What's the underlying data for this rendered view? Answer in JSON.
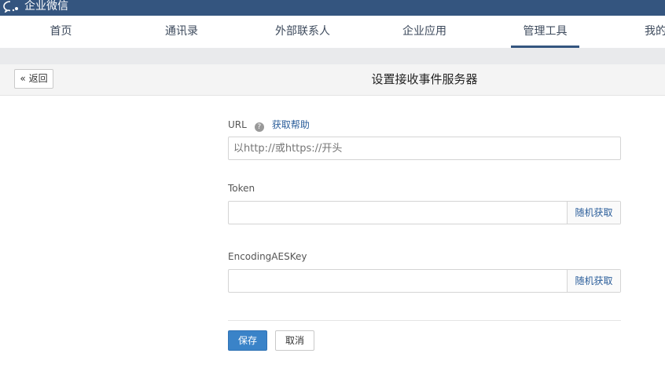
{
  "app": {
    "title": "企业微信"
  },
  "nav": {
    "items": [
      {
        "label": "首页"
      },
      {
        "label": "通讯录"
      },
      {
        "label": "外部联系人"
      },
      {
        "label": "企业应用"
      },
      {
        "label": "管理工具"
      },
      {
        "label": "我的企业"
      }
    ],
    "active": "管理工具"
  },
  "page": {
    "back_label": "返回",
    "title": "设置接收事件服务器"
  },
  "form": {
    "url": {
      "label": "URL",
      "help_link": "获取帮助",
      "placeholder": "以http://或https://开头",
      "value": ""
    },
    "token": {
      "label": "Token",
      "value": "",
      "button": "随机获取"
    },
    "aeskey": {
      "label": "EncodingAESKey",
      "value": "",
      "button": "随机获取"
    },
    "save_label": "保存",
    "cancel_label": "取消"
  },
  "colors": {
    "header": "#34557f",
    "primary": "#3a83c8",
    "link": "#2a5d9a"
  }
}
